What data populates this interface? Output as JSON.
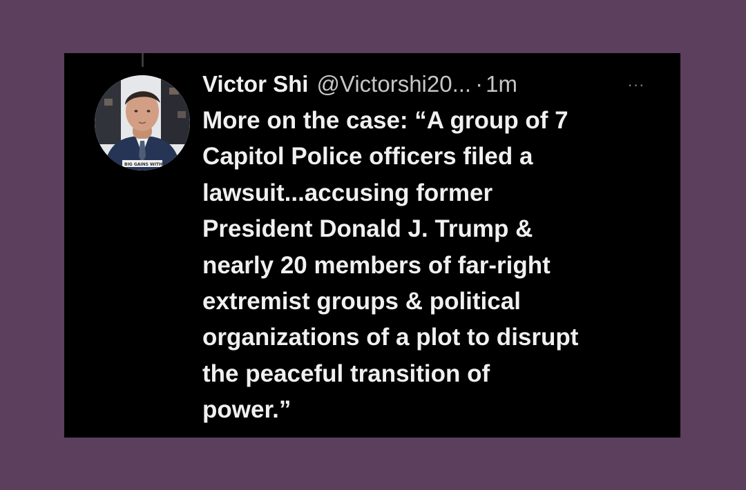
{
  "tweet": {
    "display_name": "Victor Shi",
    "handle": "@Victorshi20...",
    "separator": "·",
    "time": "1m",
    "more_label": "···",
    "text": "More on the case: “A group of 7\nCapitol Police officers filed a\nlawsuit...accusing former\nPresident Donald J. Trump &\nnearly 20 members of far-right\nextremist groups & political\norganizations of a plot to disrupt\nthe peaceful transition of\npower.”",
    "avatar_caption": "BIG GAINS WITH V"
  },
  "icons": {
    "more": "more-horizontal-icon",
    "avatar": "avatar-photo"
  },
  "colors": {
    "page_background": "#5b3f5c",
    "card_background": "#000000",
    "name_text": "#f0f0f0",
    "meta_text": "#c6c6c6",
    "body_text": "#f0f0f0"
  }
}
